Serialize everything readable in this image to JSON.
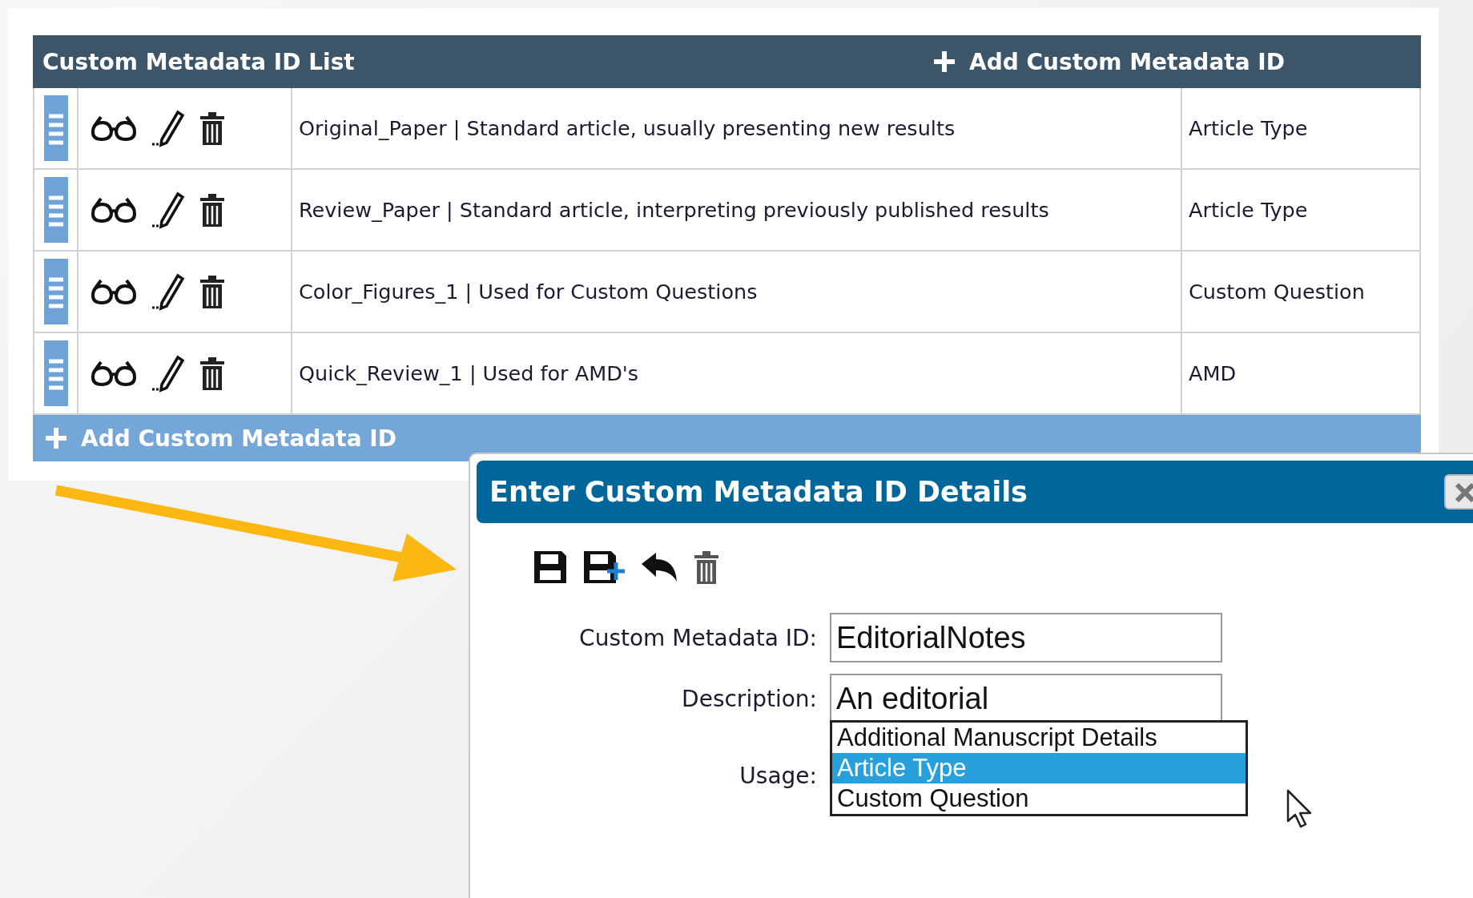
{
  "list": {
    "title": "Custom Metadata ID List",
    "add_label": "Add Custom Metadata ID",
    "rows": [
      {
        "description": "Original_Paper | Standard article, usually presenting new results",
        "usage": "Article Type"
      },
      {
        "description": "Review_Paper | Standard article, interpreting previously published results",
        "usage": "Article Type"
      },
      {
        "description": "Color_Figures_1 | Used for Custom Questions",
        "usage": "Custom Question"
      },
      {
        "description": "Quick_Review_1 | Used for AMD's",
        "usage": "AMD"
      }
    ],
    "footer_add_label": "Add Custom Metadata ID"
  },
  "dialog": {
    "title": "Enter Custom Metadata ID Details",
    "fields": [
      {
        "kind": "text",
        "label": "Custom Metadata ID:",
        "value": "EditorialNotes"
      },
      {
        "kind": "text",
        "label": "Description:",
        "value": "An editorial"
      },
      {
        "kind": "listbox",
        "label": "Usage:",
        "options": [
          {
            "label": "Additional Manuscript Details",
            "selected": false
          },
          {
            "label": "Article Type",
            "selected": true
          },
          {
            "label": "Custom Question",
            "selected": false
          }
        ]
      }
    ]
  }
}
